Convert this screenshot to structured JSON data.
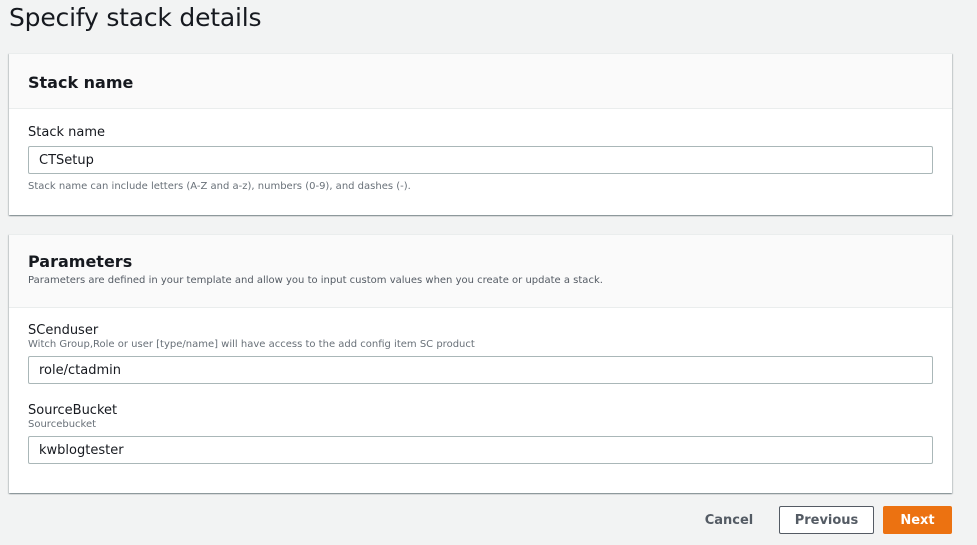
{
  "page": {
    "title": "Specify stack details"
  },
  "stack_name_panel": {
    "heading": "Stack name",
    "field_label": "Stack name",
    "field_value": "CTSetup",
    "constraint": "Stack name can include letters (A-Z and a-z), numbers (0-9), and dashes (-)."
  },
  "parameters_panel": {
    "heading": "Parameters",
    "description": "Parameters are defined in your template and allow you to input custom values when you create or update a stack.",
    "params": [
      {
        "label": "SCenduser",
        "description": "Witch Group,Role or user [type/name] will have access to the add config item SC product",
        "value": "role/ctadmin"
      },
      {
        "label": "SourceBucket",
        "description": "Sourcebucket",
        "value": "kwblogtester"
      }
    ]
  },
  "footer": {
    "cancel_label": "Cancel",
    "previous_label": "Previous",
    "next_label": "Next"
  },
  "colors": {
    "primary_button": "#ec7211",
    "background": "#f2f3f3",
    "panel_header": "#fafafa"
  }
}
